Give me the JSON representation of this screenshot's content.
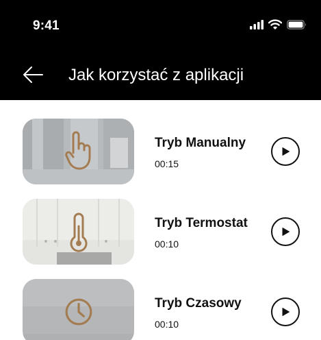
{
  "status_bar": {
    "time": "9:41",
    "icons": [
      "signal-icon",
      "wifi-icon",
      "battery-icon"
    ]
  },
  "header": {
    "back_icon": "arrow-left-icon",
    "title": "Jak korzystać z aplikacji"
  },
  "colors": {
    "header_bg": "#000000",
    "header_text": "#ffffff",
    "icon_accent": "#a47c52",
    "text": "#111111"
  },
  "videos": [
    {
      "title": "Tryb Manualny",
      "duration": "00:15",
      "icon": "hand-pointer-icon"
    },
    {
      "title": "Tryb Termostat",
      "duration": "00:10",
      "icon": "thermometer-icon"
    },
    {
      "title": "Tryb Czasowy",
      "duration": "00:10",
      "icon": "clock-icon"
    }
  ]
}
